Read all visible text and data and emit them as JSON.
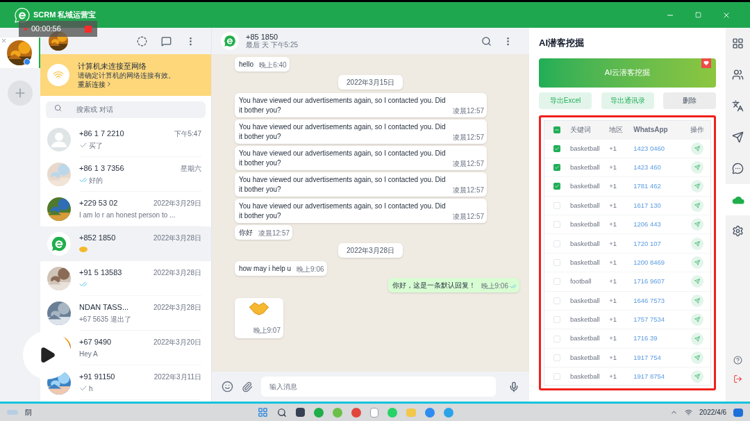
{
  "app": {
    "title": "SCRM 私域运营宝"
  },
  "recorder": {
    "time": "00:00:56"
  },
  "banner": {
    "title": "计算机未连接至网络",
    "text": "请确定计算机的网络连接有效。",
    "link": "重新连接"
  },
  "search": {
    "placeholder": "搜索或 对话"
  },
  "chats": [
    {
      "name": "+86 1 7 2210",
      "time": "下午5:47",
      "preview": "买了",
      "receipt": {
        "kind": "single"
      },
      "avatar": {
        "kind": "blank"
      },
      "selected": false
    },
    {
      "name": "+86 1 3 7356",
      "time": "星期六",
      "preview": "好的",
      "receipt": {
        "kind": "double"
      },
      "selected": false
    },
    {
      "name": "+229 53 02",
      "time": "2022年3月29日",
      "preview": "I am lo r an honest person to ...",
      "selected": false
    },
    {
      "name": "+852 1850",
      "time": "2022年3月28日",
      "receipt": {
        "kind": "emoji"
      },
      "avatar": {
        "kind": "logo"
      },
      "selected": true
    },
    {
      "name": "+91 5 13583",
      "time": "2022年3月28日",
      "receipt": {
        "kind": "double"
      },
      "selected": false
    },
    {
      "name": "NDAN TASS...",
      "time": "2022年3月28日",
      "preview": "+67 5635 退出了",
      "selected": false
    },
    {
      "name": "+67 9490",
      "time": "2022年3月20日",
      "preview": "Hey A",
      "selected": false
    },
    {
      "name": "+91 91150",
      "time": "2022年3月11日",
      "preview": "h",
      "receipt": {
        "kind": "single"
      },
      "selected": false
    }
  ],
  "chat_header": {
    "name": "+85 1850",
    "status": "最后 天 下午5:25"
  },
  "messages": [
    {
      "kind": "in",
      "text": "hello",
      "time": "晚上6:40"
    },
    {
      "kind": "date",
      "text": "2022年3月15日"
    },
    {
      "kind": "in",
      "text": "You have viewed our advertisements again, so I contacted you. Did it bother you?",
      "time": "凌晨12:57"
    },
    {
      "kind": "in",
      "text": "You have viewed our advertisements again, so I contacted you. Did it bother you?",
      "time": "凌晨12:57"
    },
    {
      "kind": "in",
      "text": "You have viewed our advertisements again, so I contacted you. Did it bother you?",
      "time": "凌晨12:57"
    },
    {
      "kind": "in",
      "text": "You have viewed our advertisements again, so I contacted you. Did it bother you?",
      "time": "凌晨12:57"
    },
    {
      "kind": "in",
      "text": "You have viewed our advertisements again, so I contacted you. Did it bother you?",
      "time": "凌晨12:57"
    },
    {
      "kind": "in",
      "text": "你好",
      "time": "凌晨12:57"
    },
    {
      "kind": "date",
      "text": "2022年3月28日"
    },
    {
      "kind": "in",
      "text": "how may i help u",
      "time": "晚上9:06"
    },
    {
      "kind": "out",
      "text": "你好，这是一条默认回复！",
      "time": "晚上9:06"
    },
    {
      "kind": "sticker",
      "time": "晚上9:07"
    }
  ],
  "composer": {
    "placeholder": "输入消息"
  },
  "panel": {
    "title": "AI潜客挖掘",
    "main_button": "AI云潜客挖掘",
    "buttons": [
      {
        "label": "导出Excel",
        "kind": "green"
      },
      {
        "label": "导出通讯录",
        "kind": "green"
      },
      {
        "label": "删除",
        "kind": "gray"
      }
    ],
    "header_indeterminate": true,
    "columns": [
      "关键词",
      "地区",
      "WhatsApp",
      "操作"
    ],
    "rows": [
      {
        "keyword": "basketball",
        "region": "+1",
        "number": "1423 0460",
        "checked": true
      },
      {
        "keyword": "basketball",
        "region": "+1",
        "number": "1423 460",
        "checked": true
      },
      {
        "keyword": "basketball",
        "region": "+1",
        "number": "1781 462",
        "checked": true
      },
      {
        "keyword": "basketball",
        "region": "+1",
        "number": "1617 130",
        "checked": false
      },
      {
        "keyword": "basketball",
        "region": "+1",
        "number": "1206 443",
        "checked": false
      },
      {
        "keyword": "basketball",
        "region": "+1",
        "number": "1720 107",
        "checked": false
      },
      {
        "keyword": "basketball",
        "region": "+1",
        "number": "1200 8469",
        "checked": false
      },
      {
        "keyword": "football",
        "region": "+1",
        "number": "1716 9607",
        "checked": false
      },
      {
        "keyword": "basketball",
        "region": "+1",
        "number": "1646 7573",
        "checked": false
      },
      {
        "keyword": "basketball",
        "region": "+1",
        "number": "1757 7534",
        "checked": false
      },
      {
        "keyword": "basketball",
        "region": "+1",
        "number": "1716 39",
        "checked": false
      },
      {
        "keyword": "basketball",
        "region": "+1",
        "number": "1917 754",
        "checked": false
      },
      {
        "keyword": "basketball",
        "region": "+1",
        "number": "1917 8754",
        "checked": false
      }
    ]
  },
  "side_tools": [
    {
      "kind": "apps",
      "selected": false
    },
    {
      "kind": "contacts",
      "selected": false
    },
    {
      "kind": "translate",
      "selected": false
    },
    {
      "kind": "send",
      "selected": false
    },
    {
      "kind": "chat",
      "selected": false
    },
    {
      "kind": "ai",
      "selected": true
    },
    {
      "kind": "settings",
      "selected": false
    }
  ],
  "taskbar": {
    "weather": "阴",
    "date": "2022/4/6"
  }
}
